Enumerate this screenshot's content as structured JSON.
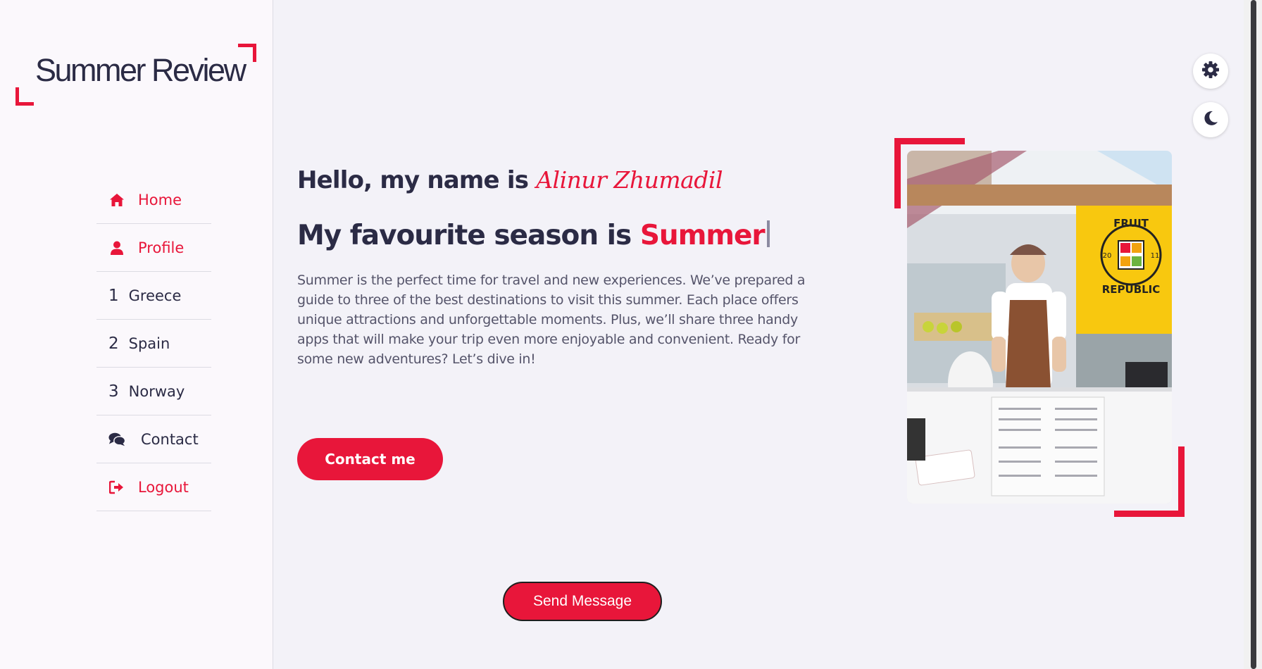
{
  "brand": {
    "logo_text": "Summer Review"
  },
  "nav": {
    "items": [
      {
        "label": "Home",
        "icon": "home-icon"
      },
      {
        "label": "Profile",
        "icon": "user-icon"
      },
      {
        "label": "Greece",
        "number": "1"
      },
      {
        "label": "Spain",
        "number": "2"
      },
      {
        "label": "Norway",
        "number": "3"
      },
      {
        "label": "Contact",
        "icon": "comments-icon"
      },
      {
        "label": "Logout",
        "icon": "logout-icon"
      }
    ]
  },
  "hero": {
    "greeting": "Hello, my name is",
    "name": "Alinur Zhumadil",
    "season_prefix": "My favourite season is",
    "season": "Summer",
    "intro": "Summer is the perfect time for travel and new experiences. We’ve prepared a guide to three of the best destinations to visit this summer. Each place offers unique attractions and unforgettable moments. Plus, we’ll share three handy apps that will make your trip even more enjoyable and convenient. Ready for some new adventures? Let’s dive in!",
    "contact_label": "Contact me",
    "send_label": "Send Message"
  },
  "photo": {
    "sign_line1": "FRUIT",
    "sign_line2": "REPUBLIC",
    "sign_year_left": "20",
    "sign_year_right": "11"
  },
  "controls": {
    "settings_icon": "gear-icon",
    "theme_icon": "moon-icon"
  },
  "colors": {
    "accent": "#e8163a",
    "text": "#2b2b45",
    "background": "#f3f2f8",
    "sidebar": "#fbf8fc"
  }
}
